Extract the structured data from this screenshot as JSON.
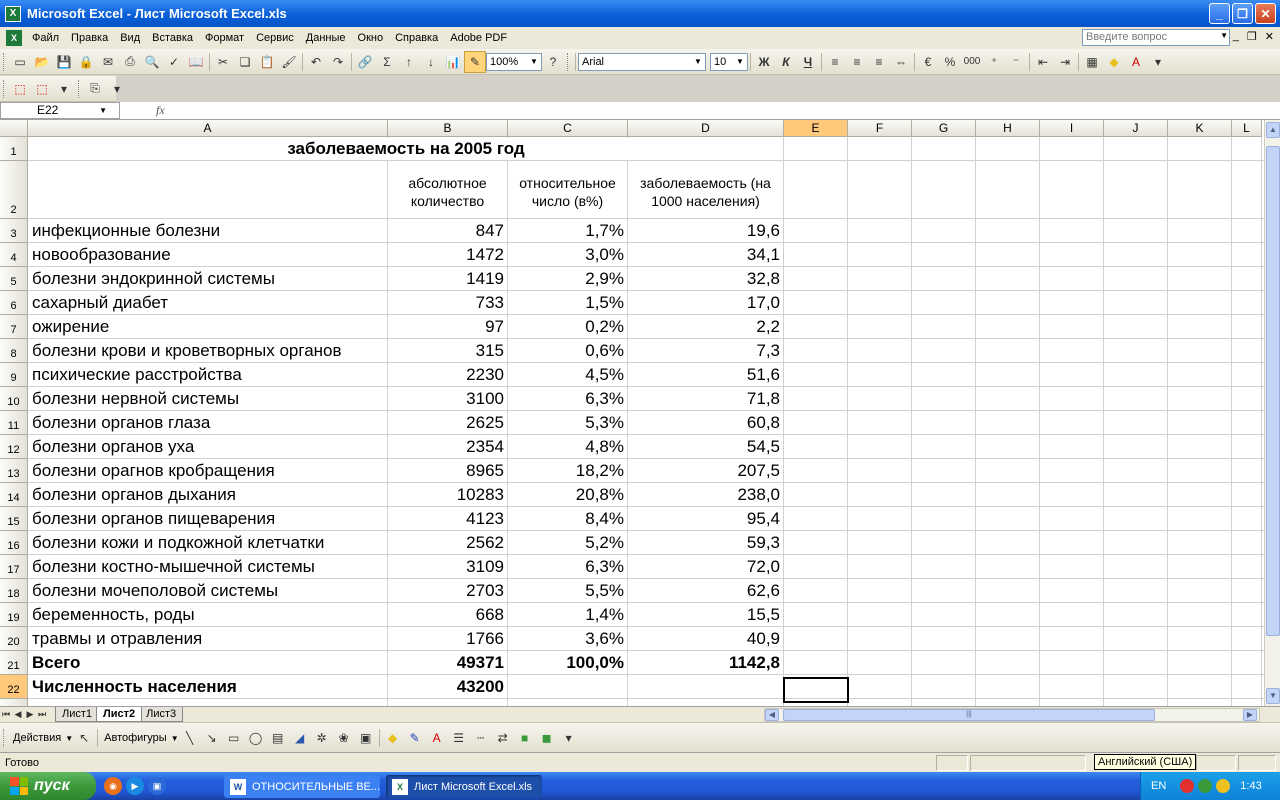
{
  "window": {
    "title": "Microsoft Excel - Лист Microsoft Excel.xls",
    "app_icon": "X",
    "controls": [
      "_",
      "❐",
      "✕"
    ]
  },
  "menu": {
    "items": [
      "Файл",
      "Правка",
      "Вид",
      "Вставка",
      "Формат",
      "Сервис",
      "Данные",
      "Окно",
      "Справка",
      "Adobe PDF"
    ],
    "ask_placeholder": "Введите вопрос",
    "mdi_controls": [
      "_",
      "❐",
      "✕"
    ]
  },
  "toolbar": {
    "zoom": "100%",
    "font": "Arial",
    "font_size": "10",
    "bold": "Ж",
    "italic": "К",
    "underline": "Ч",
    "percent": "%",
    "thousands": "000"
  },
  "formula_bar": {
    "name_box": "E22",
    "fx": "fx",
    "content": ""
  },
  "grid": {
    "columns": [
      "A",
      "B",
      "C",
      "D",
      "E",
      "F",
      "G",
      "H",
      "I",
      "J",
      "K",
      "L"
    ],
    "selected_column": "E",
    "selected_row": "22",
    "title": "заболеваемость на 2005 год",
    "headers": {
      "b": [
        "абсолютное",
        "количество"
      ],
      "c": [
        "относительное",
        "число (в%)"
      ],
      "d": [
        "заболеваемость (на",
        "1000 населения)"
      ]
    },
    "rows": [
      {
        "n": "3",
        "a": "инфекционные болезни",
        "b": "847",
        "c": "1,7%",
        "d": "19,6"
      },
      {
        "n": "4",
        "a": "новообразование",
        "b": "1472",
        "c": "3,0%",
        "d": "34,1"
      },
      {
        "n": "5",
        "a": "болезни эндокринной системы",
        "b": "1419",
        "c": "2,9%",
        "d": "32,8"
      },
      {
        "n": "6",
        "a": "сахарный диабет",
        "b": "733",
        "c": "1,5%",
        "d": "17,0"
      },
      {
        "n": "7",
        "a": "ожирение",
        "b": "97",
        "c": "0,2%",
        "d": "2,2"
      },
      {
        "n": "8",
        "a": "болезни крови и кроветворных органов",
        "b": "315",
        "c": "0,6%",
        "d": "7,3"
      },
      {
        "n": "9",
        "a": "психические расстройства",
        "b": "2230",
        "c": "4,5%",
        "d": "51,6"
      },
      {
        "n": "10",
        "a": "болезни нервной системы",
        "b": "3100",
        "c": "6,3%",
        "d": "71,8"
      },
      {
        "n": "11",
        "a": "болезни органов глаза",
        "b": "2625",
        "c": "5,3%",
        "d": "60,8"
      },
      {
        "n": "12",
        "a": "болезни органов уха",
        "b": "2354",
        "c": "4,8%",
        "d": "54,5"
      },
      {
        "n": "13",
        "a": "болезни орагнов кробращения",
        "b": "8965",
        "c": "18,2%",
        "d": "207,5"
      },
      {
        "n": "14",
        "a": "болезни органов дыхания",
        "b": "10283",
        "c": "20,8%",
        "d": "238,0"
      },
      {
        "n": "15",
        "a": "болезни органов пищеварения",
        "b": "4123",
        "c": "8,4%",
        "d": "95,4"
      },
      {
        "n": "16",
        "a": "болезни кожи и подкожной клетчатки",
        "b": "2562",
        "c": "5,2%",
        "d": "59,3"
      },
      {
        "n": "17",
        "a": "болезни костно-мышечной системы",
        "b": "3109",
        "c": "6,3%",
        "d": "72,0"
      },
      {
        "n": "18",
        "a": "болезни мочеполовой системы",
        "b": "2703",
        "c": "5,5%",
        "d": "62,6"
      },
      {
        "n": "19",
        "a": "беременность, роды",
        "b": "668",
        "c": "1,4%",
        "d": "15,5"
      },
      {
        "n": "20",
        "a": "травмы и отравления",
        "b": "1766",
        "c": "3,6%",
        "d": "40,9"
      },
      {
        "n": "21",
        "a": "Всего",
        "b": "49371",
        "c": "100,0%",
        "d": "1142,8",
        "bold": true
      },
      {
        "n": "22",
        "a": "Численность населения",
        "b": "43200",
        "c": "",
        "d": "",
        "bold": true
      }
    ]
  },
  "sheets": {
    "tabs": [
      "Лист1",
      "Лист2",
      "Лист3"
    ],
    "active": "Лист2"
  },
  "drawing": {
    "actions": "Действия",
    "autoshapes": "Автофигуры"
  },
  "status": {
    "text": "Готово",
    "tooltip": "Английский (США)"
  },
  "taskbar": {
    "start": "пуск",
    "tasks": [
      {
        "label": "ОТНОСИТЕЛЬНЫЕ ВЕ...",
        "icon": "W",
        "active": false
      },
      {
        "label": "Лист Microsoft Excel.xls",
        "icon": "X",
        "active": true
      }
    ],
    "lang": "EN",
    "clock": "1:43"
  },
  "colors": {
    "title_bar": "#0a5fd8",
    "selected_header": "#ffc87a",
    "taskbar": "#245edb",
    "start_button": "#3c9a3c",
    "excel_green": "#1e7a3a"
  }
}
